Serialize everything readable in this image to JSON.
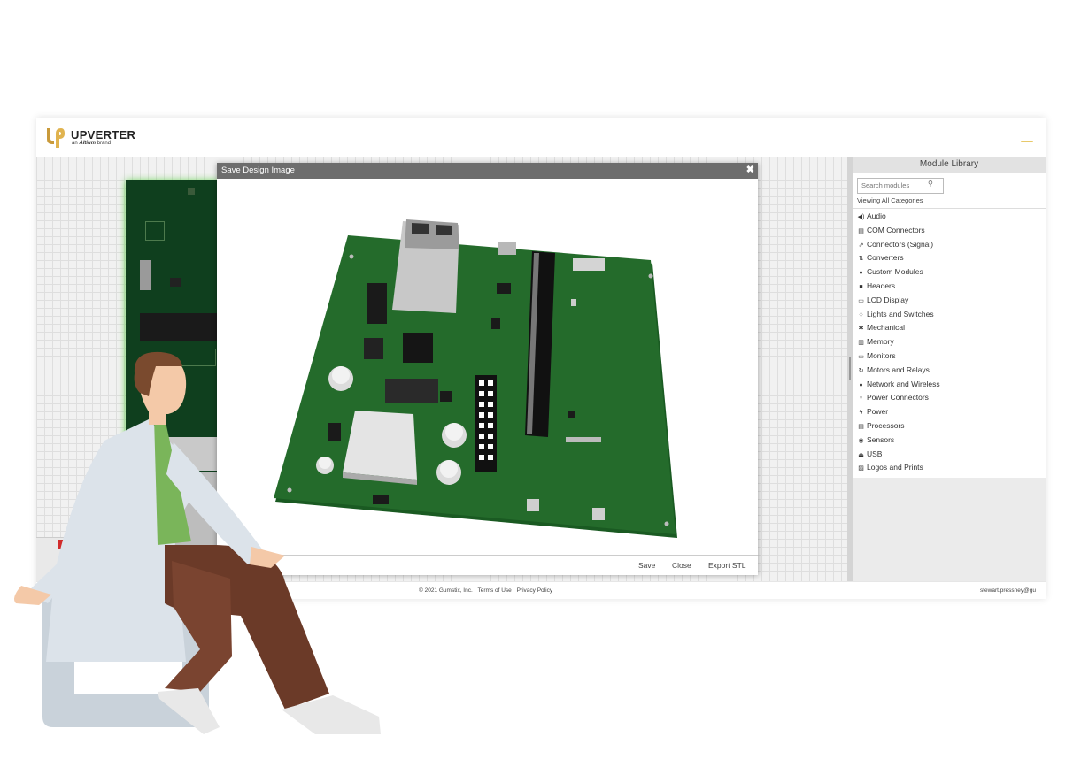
{
  "header": {
    "brand_name": "UPVERTER",
    "brand_prefix": "an",
    "brand_company": "Altium",
    "brand_suffix": "brand"
  },
  "sidebar": {
    "title": "Module Library",
    "search_placeholder": "Search modules",
    "viewing_text": "Viewing All Categories",
    "items": [
      {
        "label": "Audio",
        "icon": "speaker-icon",
        "glyph": "◀)"
      },
      {
        "label": "COM Connectors",
        "icon": "com-connector-icon",
        "glyph": "▤"
      },
      {
        "label": "Connectors (Signal)",
        "icon": "signal-connector-icon",
        "glyph": "⇗"
      },
      {
        "label": "Converters",
        "icon": "converter-icon",
        "glyph": "⇅"
      },
      {
        "label": "Custom Modules",
        "icon": "custom-module-icon",
        "glyph": "●"
      },
      {
        "label": "Headers",
        "icon": "header-icon",
        "glyph": "■"
      },
      {
        "label": "LCD Display",
        "icon": "lcd-icon",
        "glyph": "▭"
      },
      {
        "label": "Lights and Switches",
        "icon": "lightbulb-icon",
        "glyph": "♢"
      },
      {
        "label": "Mechanical",
        "icon": "gear-icon",
        "glyph": "✱"
      },
      {
        "label": "Memory",
        "icon": "memory-icon",
        "glyph": "▥"
      },
      {
        "label": "Monitors",
        "icon": "monitor-icon",
        "glyph": "▭"
      },
      {
        "label": "Motors and Relays",
        "icon": "motor-icon",
        "glyph": "↻"
      },
      {
        "label": "Network and Wireless",
        "icon": "globe-icon",
        "glyph": "●"
      },
      {
        "label": "Power Connectors",
        "icon": "plug-icon",
        "glyph": "♆"
      },
      {
        "label": "Power",
        "icon": "lightning-icon",
        "glyph": "ϟ"
      },
      {
        "label": "Processors",
        "icon": "processor-icon",
        "glyph": "▤"
      },
      {
        "label": "Sensors",
        "icon": "sensor-icon",
        "glyph": "◉"
      },
      {
        "label": "USB",
        "icon": "usb-icon",
        "glyph": "⏏"
      },
      {
        "label": "Logos and Prints",
        "icon": "image-icon",
        "glyph": "▨"
      }
    ]
  },
  "modal": {
    "title": "Save Design Image",
    "close_glyph": "✖",
    "buttons": {
      "save": "Save",
      "close": "Close",
      "export": "Export STL"
    }
  },
  "footer": {
    "copyright": "© 2021 Gumstix, Inc.",
    "terms": "Terms of Use",
    "privacy": "Privacy Policy",
    "user": "stewart.pressney@gu"
  },
  "colors": {
    "pcb_green": "#1f6b2a",
    "modal_header": "#6d6d6d",
    "brand_gold": "#c99a3b"
  }
}
